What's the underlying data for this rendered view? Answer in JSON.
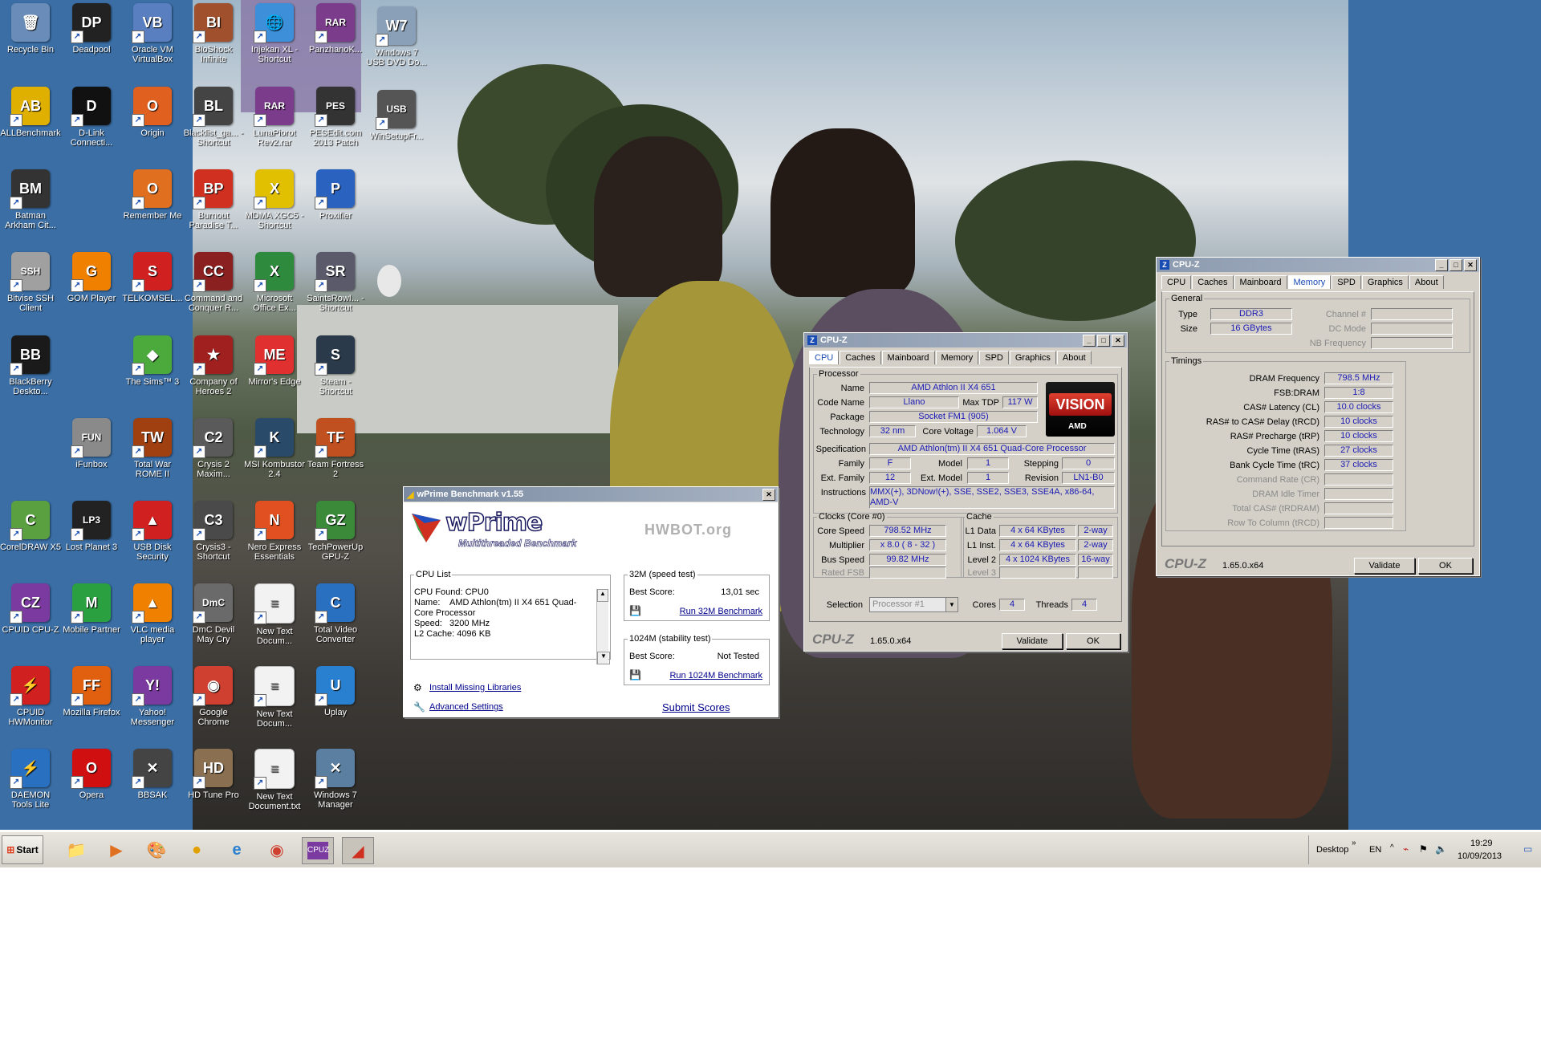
{
  "desktop_icons": [
    {
      "label": "Recycle Bin",
      "icon": "recycle-bin-icon",
      "color": "#6a8cb8",
      "glyph": "🗑"
    },
    {
      "label": "Deadpool",
      "icon": "deadpool-icon",
      "color": "#222222",
      "glyph": "DP"
    },
    {
      "label": "Oracle VM VirtualBox",
      "icon": "virtualbox-icon",
      "color": "#5a7fc0",
      "glyph": "VB"
    },
    {
      "label": "BioShock Infinite",
      "icon": "bioshock-icon",
      "color": "#a0502c",
      "glyph": "BI"
    },
    {
      "label": "Injekan XL - Shortcut",
      "icon": "globe-icon",
      "color": "#3c8fd8",
      "glyph": "🌐"
    },
    {
      "label": "PanzhanoK...",
      "icon": "winrar-icon",
      "color": "#7b3c8c",
      "glyph": "RAR"
    },
    {
      "label": "Windows 7 USB DVD Do...",
      "icon": "usb-dvd-icon",
      "color": "#8aa0b8",
      "glyph": "W7"
    },
    {
      "label": "ALLBenchmark",
      "icon": "allbenchmark-icon",
      "color": "#e0b000",
      "glyph": "AB"
    },
    {
      "label": "D-Link Connecti...",
      "icon": "dlink-icon",
      "color": "#111111",
      "glyph": "D"
    },
    {
      "label": "Origin",
      "icon": "origin-icon",
      "color": "#e06020",
      "glyph": "O"
    },
    {
      "label": "Blacklist_ga... - Shortcut",
      "icon": "blacklist-icon",
      "color": "#444444",
      "glyph": "BL"
    },
    {
      "label": "LunaPiorot Rev2.rar",
      "icon": "winrar-icon",
      "color": "#7b3c8c",
      "glyph": "RAR"
    },
    {
      "label": "PESEdit.com 2013 Patch",
      "icon": "pesedit-icon",
      "color": "#333333",
      "glyph": "PES"
    },
    {
      "label": "WinSetupFr...",
      "icon": "usb-drive-icon",
      "color": "#555555",
      "glyph": "USB"
    },
    {
      "label": "Batman Arkham Cit...",
      "icon": "batman-icon",
      "color": "#333333",
      "glyph": "BM"
    },
    {
      "label": "Remember Me",
      "icon": "origin-icon",
      "color": "#e07020",
      "glyph": "O"
    },
    {
      "label": "Burnout Paradise T...",
      "icon": "burnout-icon",
      "color": "#d03020",
      "glyph": "BP"
    },
    {
      "label": "MDMA XGC5 - Shortcut",
      "icon": "mdma-icon",
      "color": "#e0c000",
      "glyph": "X"
    },
    {
      "label": "Proxifier",
      "icon": "proxifier-icon",
      "color": "#2a62c0",
      "glyph": "P"
    },
    {
      "label": "Bitvise SSH Client",
      "icon": "bitvise-icon",
      "color": "#a0a0a0",
      "glyph": "SSH"
    },
    {
      "label": "GOM Player",
      "icon": "gom-player-icon",
      "color": "#f08000",
      "glyph": "G"
    },
    {
      "label": "TELKOMSEL...",
      "icon": "telkomsel-icon",
      "color": "#d02020",
      "glyph": "S"
    },
    {
      "label": "Command and Conquer R...",
      "icon": "cnc-icon",
      "color": "#8a2020",
      "glyph": "CC"
    },
    {
      "label": "Microsoft Office Ex...",
      "icon": "excel-icon",
      "color": "#2e8b3e",
      "glyph": "X"
    },
    {
      "label": "SaintsRowI... - Shortcut",
      "icon": "saints-row-icon",
      "color": "#5a5a6a",
      "glyph": "SR"
    },
    {
      "label": "BlackBerry Deskto...",
      "icon": "blackberry-icon",
      "color": "#1a1a1a",
      "glyph": "BB"
    },
    {
      "label": "The Sims™ 3",
      "icon": "sims-icon",
      "color": "#4caa3c",
      "glyph": "◆"
    },
    {
      "label": "Company of Heroes 2",
      "icon": "coh-icon",
      "color": "#a02020",
      "glyph": "★"
    },
    {
      "label": "Mirror's Edge",
      "icon": "mirrors-edge-icon",
      "color": "#e03030",
      "glyph": "ME"
    },
    {
      "label": "Steam - Shortcut",
      "icon": "steam-icon",
      "color": "#2a3a4a",
      "glyph": "S"
    },
    {
      "label": "iFunbox",
      "icon": "ifunbox-icon",
      "color": "#8a8a8a",
      "glyph": "FUN"
    },
    {
      "label": "Total War ROME II",
      "icon": "total-war-icon",
      "color": "#a04010",
      "glyph": "TW"
    },
    {
      "label": "Crysis 2 Maxim...",
      "icon": "crysis-icon",
      "color": "#5a5a5a",
      "glyph": "C2"
    },
    {
      "label": "MSI Kombustor 2.4",
      "icon": "kombustor-icon",
      "color": "#2a4a6a",
      "glyph": "K"
    },
    {
      "label": "Team Fortress 2",
      "icon": "tf2-icon",
      "color": "#c05020",
      "glyph": "TF"
    },
    {
      "label": "CorelDRAW X5",
      "icon": "coreldraw-icon",
      "color": "#5aa040",
      "glyph": "C"
    },
    {
      "label": "Lost Planet 3",
      "icon": "lost-planet-icon",
      "color": "#222222",
      "glyph": "LP3"
    },
    {
      "label": "USB Disk Security",
      "icon": "usb-security-icon",
      "color": "#d02020",
      "glyph": "▲"
    },
    {
      "label": "Crysis3 - Shortcut",
      "icon": "crysis-icon",
      "color": "#4a4a4a",
      "glyph": "C3"
    },
    {
      "label": "Nero Express Essentials",
      "icon": "nero-icon",
      "color": "#e05020",
      "glyph": "N"
    },
    {
      "label": "TechPowerUp GPU-Z",
      "icon": "gpuz-icon",
      "color": "#3a8a3a",
      "glyph": "GZ"
    },
    {
      "label": "CPUID CPU-Z",
      "icon": "cpuz-icon",
      "color": "#7a3aa0",
      "glyph": "CZ"
    },
    {
      "label": "Mobile Partner",
      "icon": "mobile-partner-icon",
      "color": "#2aa040",
      "glyph": "M"
    },
    {
      "label": "VLC media player",
      "icon": "vlc-icon",
      "color": "#f08000",
      "glyph": "▲"
    },
    {
      "label": "DmC Devil May Cry",
      "icon": "dmc-icon",
      "color": "#6a6a6a",
      "glyph": "DmC"
    },
    {
      "label": "New Text Docum...",
      "icon": "text-document-icon",
      "color": "#f2f2f2",
      "glyph": "≡"
    },
    {
      "label": "Total Video Converter",
      "icon": "video-converter-icon",
      "color": "#2a70c0",
      "glyph": "C"
    },
    {
      "label": "CPUID HWMonitor",
      "icon": "hwmonitor-icon",
      "color": "#d02020",
      "glyph": "⚡"
    },
    {
      "label": "Mozilla Firefox",
      "icon": "firefox-icon",
      "color": "#e06010",
      "glyph": "FF"
    },
    {
      "label": "Yahoo! Messenger",
      "icon": "yahoo-messenger-icon",
      "color": "#7a3aa0",
      "glyph": "Y!"
    },
    {
      "label": "Google Chrome",
      "icon": "chrome-icon",
      "color": "#d04030",
      "glyph": "◉"
    },
    {
      "label": "New Text Docum...",
      "icon": "text-document-icon",
      "color": "#f2f2f2",
      "glyph": "≡"
    },
    {
      "label": "Uplay",
      "icon": "uplay-icon",
      "color": "#2a80d0",
      "glyph": "U"
    },
    {
      "label": "DAEMON Tools Lite",
      "icon": "daemon-tools-icon",
      "color": "#2a70c0",
      "glyph": "⚡"
    },
    {
      "label": "Opera",
      "icon": "opera-icon",
      "color": "#d01010",
      "glyph": "O"
    },
    {
      "label": "BBSAK",
      "icon": "bbsak-icon",
      "color": "#444444",
      "glyph": "✕"
    },
    {
      "label": "HD Tune Pro",
      "icon": "hd-tune-icon",
      "color": "#8a7050",
      "glyph": "HD"
    },
    {
      "label": "New Text Document.txt",
      "icon": "text-document-icon",
      "color": "#f2f2f2",
      "glyph": "≡"
    },
    {
      "label": "Windows 7 Manager",
      "icon": "win7-manager-icon",
      "color": "#5a7fa0",
      "glyph": "✕"
    }
  ],
  "wprime": {
    "title": "wPrime Benchmark v1.55",
    "logo": "wPrime",
    "tagline": "Multithreaded Benchmark",
    "hwbot": "HWBOT.org",
    "cpu_list_label": "CPU List",
    "cpu_list_text": "CPU Found: CPU0\nName:    AMD Athlon(tm) II X4 651 Quad-Core Processor\nSpeed:   3200 MHz\nL2 Cache: 4096 KB",
    "install_link": "Install Missing Libraries",
    "advanced_link": "Advanced Settings",
    "speed_test_label": "32M (speed test)",
    "best_score_label": "Best Score:",
    "speed_score": "13,01 sec",
    "run32": "Run 32M Benchmark",
    "stability_label": "1024M (stability test)",
    "stability_score": "Not Tested",
    "run1024": "Run 1024M Benchmark",
    "submit": "Submit Scores"
  },
  "cpuz_cpu": {
    "title": "CPU-Z",
    "tabs": [
      "CPU",
      "Caches",
      "Mainboard",
      "Memory",
      "SPD",
      "Graphics",
      "About"
    ],
    "active_tab": "CPU",
    "processor_label": "Processor",
    "name_label": "Name",
    "name": "AMD Athlon II X4 651",
    "codename_label": "Code Name",
    "codename": "Llano",
    "maxtdp_label": "Max TDP",
    "maxtdp": "117 W",
    "package_label": "Package",
    "package": "Socket FM1 (905)",
    "tech_label": "Technology",
    "tech": "32 nm",
    "voltage_label": "Core Voltage",
    "voltage": "1.064 V",
    "spec_label": "Specification",
    "spec": "AMD Athlon(tm) II X4 651 Quad-Core Processor",
    "family_label": "Family",
    "family": "F",
    "model_label": "Model",
    "model": "1",
    "stepping_label": "Stepping",
    "stepping": "0",
    "extfamily_label": "Ext. Family",
    "extfamily": "12",
    "extmodel_label": "Ext. Model",
    "extmodel": "1",
    "revision_label": "Revision",
    "revision": "LN1-B0",
    "instr_label": "Instructions",
    "instr": "MMX(+), 3DNow!(+), SSE, SSE2, SSE3, SSE4A, x86-64, AMD-V",
    "clocks_label": "Clocks (Core #0)",
    "corespeed_label": "Core Speed",
    "corespeed": "798.52 MHz",
    "multiplier_label": "Multiplier",
    "multiplier": "x 8.0 ( 8 - 32 )",
    "busspeed_label": "Bus Speed",
    "busspeed": "99.82 MHz",
    "ratedfsb_label": "Rated FSB",
    "cache_label": "Cache",
    "l1data_label": "L1 Data",
    "l1data": "4 x 64 KBytes",
    "l1data_way": "2-way",
    "l1inst_label": "L1 Inst.",
    "l1inst": "4 x 64 KBytes",
    "l1inst_way": "2-way",
    "l2_label": "Level 2",
    "l2": "4 x 1024 KBytes",
    "l2_way": "16-way",
    "l3_label": "Level 3",
    "selection_label": "Selection",
    "selection": "Processor #1",
    "cores_label": "Cores",
    "cores": "4",
    "threads_label": "Threads",
    "threads": "4",
    "brand": "CPU-Z",
    "version": "1.65.0.x64",
    "validate": "Validate",
    "ok": "OK",
    "vision": "VISION",
    "amd": "AMD"
  },
  "cpuz_mem": {
    "title": "CPU-Z",
    "tabs": [
      "CPU",
      "Caches",
      "Mainboard",
      "Memory",
      "SPD",
      "Graphics",
      "About"
    ],
    "active_tab": "Memory",
    "general_label": "General",
    "type_label": "Type",
    "type": "DDR3",
    "size_label": "Size",
    "size": "16 GBytes",
    "channel_label": "Channel #",
    "dcmode_label": "DC Mode",
    "nbfreq_label": "NB Frequency",
    "timings_label": "Timings",
    "timings": [
      {
        "label": "DRAM Frequency",
        "value": "798.5 MHz"
      },
      {
        "label": "FSB:DRAM",
        "value": "1:8"
      },
      {
        "label": "CAS# Latency (CL)",
        "value": "10.0 clocks"
      },
      {
        "label": "RAS# to CAS# Delay (tRCD)",
        "value": "10 clocks"
      },
      {
        "label": "RAS# Precharge (tRP)",
        "value": "10 clocks"
      },
      {
        "label": "Cycle Time (tRAS)",
        "value": "27 clocks"
      },
      {
        "label": "Bank Cycle Time (tRC)",
        "value": "37 clocks"
      },
      {
        "label": "Command Rate (CR)",
        "value": ""
      },
      {
        "label": "DRAM Idle Timer",
        "value": ""
      },
      {
        "label": "Total CAS# (tRDRAM)",
        "value": ""
      },
      {
        "label": "Row To Column (tRCD)",
        "value": ""
      }
    ],
    "brand": "CPU-Z",
    "version": "1.65.0.x64",
    "validate": "Validate",
    "ok": "OK"
  },
  "taskbar": {
    "start": "Start",
    "desktop_label": "Desktop",
    "language": "EN",
    "time": "19:29",
    "date": "10/09/2013"
  }
}
